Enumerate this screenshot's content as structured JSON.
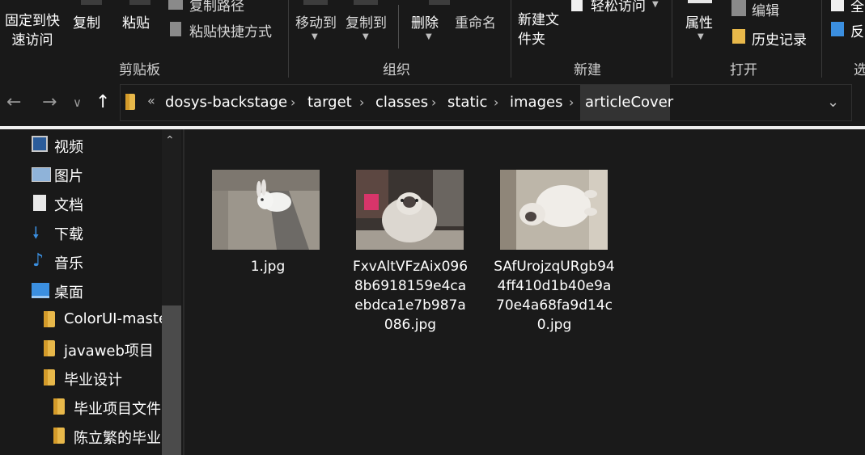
{
  "ribbon": {
    "clipboard": {
      "pin_label": "固定到快速访问",
      "copy_label": "复制",
      "paste_label": "粘贴",
      "copy_path_label": "复制路径",
      "paste_shortcut_label": "粘贴快捷方式",
      "group_label": "剪贴板"
    },
    "organize": {
      "move_to_label": "移动到",
      "copy_to_label": "复制到",
      "delete_label": "删除",
      "rename_label": "重命名",
      "group_label": "组织"
    },
    "new": {
      "new_folder_label": "新建文件夹",
      "easy_access_label": "轻松访问",
      "group_label": "新建"
    },
    "open": {
      "properties_label": "属性",
      "edit_label": "编辑",
      "history_label": "历史记录",
      "group_label": "打开"
    },
    "select": {
      "select_all_label": "全",
      "invert_label": "反",
      "group_label": "选"
    }
  },
  "address": {
    "overflow": "«",
    "crumbs": [
      "dosys-backstage",
      "target",
      "classes",
      "static",
      "images",
      "articleCover"
    ]
  },
  "sidebar": {
    "items": [
      {
        "label": "视频",
        "icon": "video-icon"
      },
      {
        "label": "图片",
        "icon": "pictures-icon"
      },
      {
        "label": "文档",
        "icon": "documents-icon"
      },
      {
        "label": "下载",
        "icon": "download-icon"
      },
      {
        "label": "音乐",
        "icon": "music-icon"
      },
      {
        "label": "桌面",
        "icon": "desktop-icon"
      },
      {
        "label": "ColorUI-maste",
        "icon": "folder-icon"
      },
      {
        "label": "javaweb项目",
        "icon": "folder-icon"
      },
      {
        "label": "毕业设计",
        "icon": "folder-icon"
      },
      {
        "label": "毕业项目文件",
        "icon": "folder-icon"
      },
      {
        "label": "陈立繁的毕业",
        "icon": "folder-icon"
      }
    ]
  },
  "files": [
    {
      "name": "1.jpg"
    },
    {
      "name": "FxvAltVFzAix0968b6918159e4caebdca1e7b987a086.jpg"
    },
    {
      "name": "SAfUrojzqURgb944ff410d1b40e9a70e4a68fa9d14c0.jpg"
    }
  ],
  "colors": {
    "background": "#191919",
    "folder": "#e8b84a",
    "accent_blue": "#3b8fe0"
  }
}
